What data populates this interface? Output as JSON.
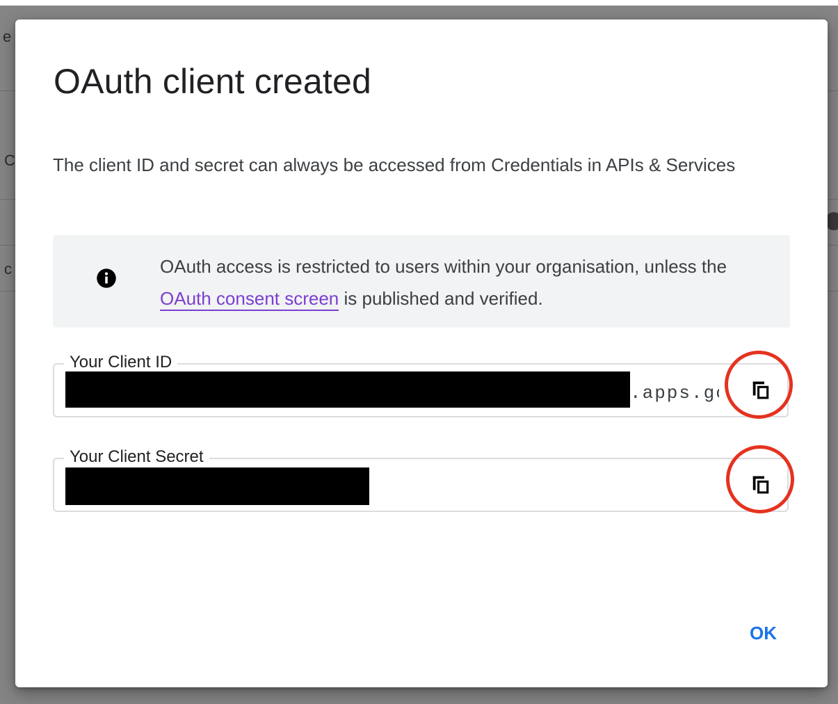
{
  "dialog": {
    "title": "OAuth client created",
    "description": "The client ID and secret can always be accessed from Credentials in APIs & Services",
    "info": {
      "icon": "info-icon",
      "text_before": "OAuth access is restricted to users within your organisation, unless the ",
      "link_text": "OAuth consent screen",
      "text_after": " is published and verified."
    },
    "client_id": {
      "label": "Your Client ID",
      "visible_suffix": ".apps.gc",
      "copy_icon": "copy-icon"
    },
    "client_secret": {
      "label": "Your Client Secret",
      "copy_icon": "copy-icon"
    },
    "ok_label": "OK"
  },
  "background_fragments": {
    "a": "e",
    "b": "C",
    "c": "c"
  },
  "colors": {
    "link": "#7b3fd0",
    "primary_button": "#1a73e8",
    "highlight_annotation": "#e53220",
    "info_banner_bg": "#f1f3f4"
  }
}
